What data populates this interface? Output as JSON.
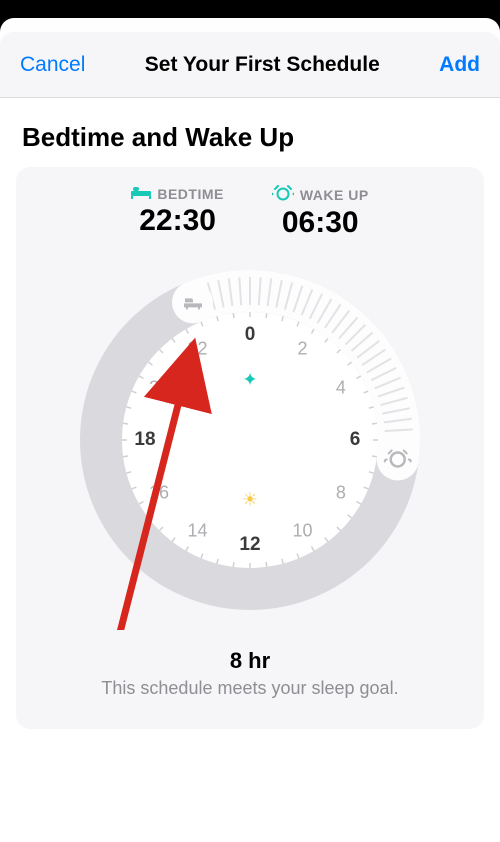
{
  "nav": {
    "cancel": "Cancel",
    "title": "Set Your First Schedule",
    "add": "Add"
  },
  "section_title": "Bedtime and Wake Up",
  "bedtime": {
    "label": "BEDTIME",
    "value": "22:30"
  },
  "wakeup": {
    "label": "WAKE UP",
    "value": "06:30"
  },
  "clock_hours": [
    "0",
    "2",
    "4",
    "6",
    "8",
    "10",
    "12",
    "14",
    "16",
    "18",
    "20",
    "22"
  ],
  "summary": {
    "hours": "8 hr",
    "note": "This schedule meets your sleep goal."
  },
  "dial": {
    "start_hour": 22.5,
    "end_hour": 6.5
  }
}
